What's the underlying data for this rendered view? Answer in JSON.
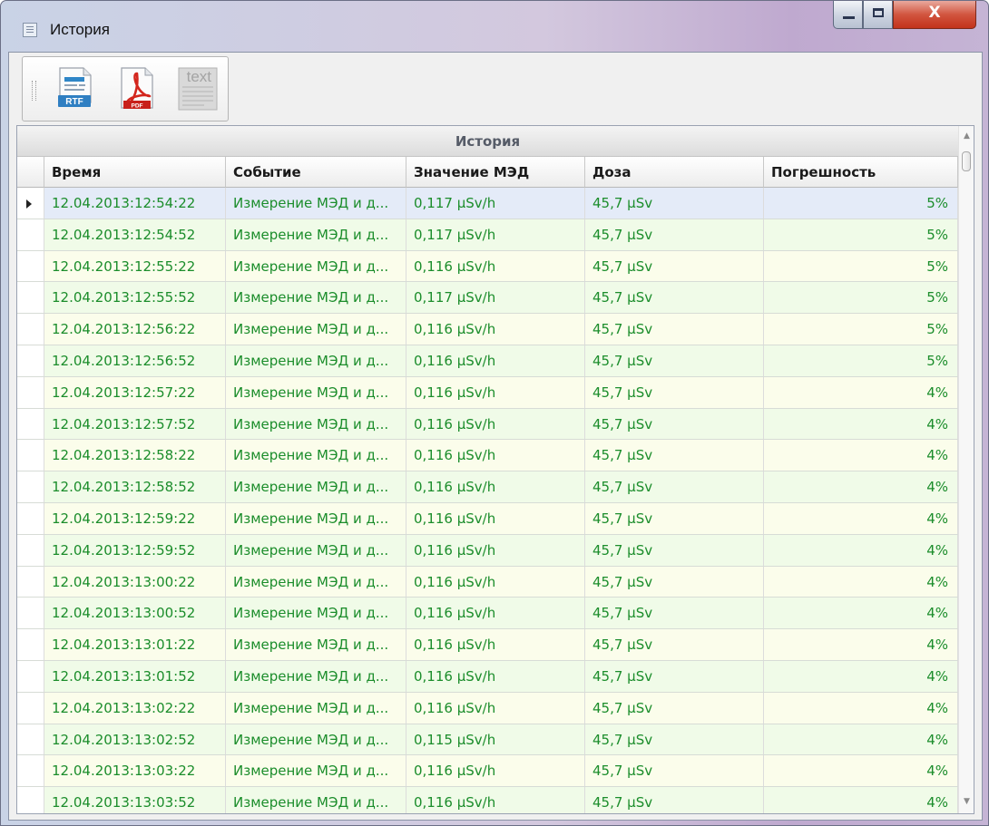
{
  "window": {
    "title": "История",
    "minimize_glyph": "",
    "close_glyph": "X"
  },
  "toolbar": {
    "rtf_label": "RTF",
    "pdf_label": "PDF",
    "text_label": "text"
  },
  "grid": {
    "group_title": "История",
    "columns": [
      "Время",
      "Событие",
      "Значение МЭД",
      "Доза",
      "Погрешность"
    ],
    "selected_row": 0,
    "rows": [
      [
        "12.04.2013:12:54:22",
        "Измерение МЭД и д...",
        "0,117 µSv/h",
        "45,7 µSv",
        "5%"
      ],
      [
        "12.04.2013:12:54:52",
        "Измерение МЭД и д...",
        "0,117 µSv/h",
        "45,7 µSv",
        "5%"
      ],
      [
        "12.04.2013:12:55:22",
        "Измерение МЭД и д...",
        "0,116 µSv/h",
        "45,7 µSv",
        "5%"
      ],
      [
        "12.04.2013:12:55:52",
        "Измерение МЭД и д...",
        "0,117 µSv/h",
        "45,7 µSv",
        "5%"
      ],
      [
        "12.04.2013:12:56:22",
        "Измерение МЭД и д...",
        "0,116 µSv/h",
        "45,7 µSv",
        "5%"
      ],
      [
        "12.04.2013:12:56:52",
        "Измерение МЭД и д...",
        "0,116 µSv/h",
        "45,7 µSv",
        "5%"
      ],
      [
        "12.04.2013:12:57:22",
        "Измерение МЭД и д...",
        "0,116 µSv/h",
        "45,7 µSv",
        "4%"
      ],
      [
        "12.04.2013:12:57:52",
        "Измерение МЭД и д...",
        "0,116 µSv/h",
        "45,7 µSv",
        "4%"
      ],
      [
        "12.04.2013:12:58:22",
        "Измерение МЭД и д...",
        "0,116 µSv/h",
        "45,7 µSv",
        "4%"
      ],
      [
        "12.04.2013:12:58:52",
        "Измерение МЭД и д...",
        "0,116 µSv/h",
        "45,7 µSv",
        "4%"
      ],
      [
        "12.04.2013:12:59:22",
        "Измерение МЭД и д...",
        "0,116 µSv/h",
        "45,7 µSv",
        "4%"
      ],
      [
        "12.04.2013:12:59:52",
        "Измерение МЭД и д...",
        "0,116 µSv/h",
        "45,7 µSv",
        "4%"
      ],
      [
        "12.04.2013:13:00:22",
        "Измерение МЭД и д...",
        "0,116 µSv/h",
        "45,7 µSv",
        "4%"
      ],
      [
        "12.04.2013:13:00:52",
        "Измерение МЭД и д...",
        "0,116 µSv/h",
        "45,7 µSv",
        "4%"
      ],
      [
        "12.04.2013:13:01:22",
        "Измерение МЭД и д...",
        "0,116 µSv/h",
        "45,7 µSv",
        "4%"
      ],
      [
        "12.04.2013:13:01:52",
        "Измерение МЭД и д...",
        "0,116 µSv/h",
        "45,7 µSv",
        "4%"
      ],
      [
        "12.04.2013:13:02:22",
        "Измерение МЭД и д...",
        "0,116 µSv/h",
        "45,7 µSv",
        "4%"
      ],
      [
        "12.04.2013:13:02:52",
        "Измерение МЭД и д...",
        "0,115 µSv/h",
        "45,7 µSv",
        "4%"
      ],
      [
        "12.04.2013:13:03:22",
        "Измерение МЭД и д...",
        "0,116 µSv/h",
        "45,7 µSv",
        "4%"
      ],
      [
        "12.04.2013:13:03:52",
        "Измерение МЭД и д...",
        "0,116 µSv/h",
        "45,7 µSv",
        "4%"
      ]
    ]
  },
  "colors": {
    "value_text": "#1b8d2b",
    "row_odd": "#f0fbe8",
    "row_even": "#fbfdeb",
    "row_selected": "#e4ebf8"
  }
}
